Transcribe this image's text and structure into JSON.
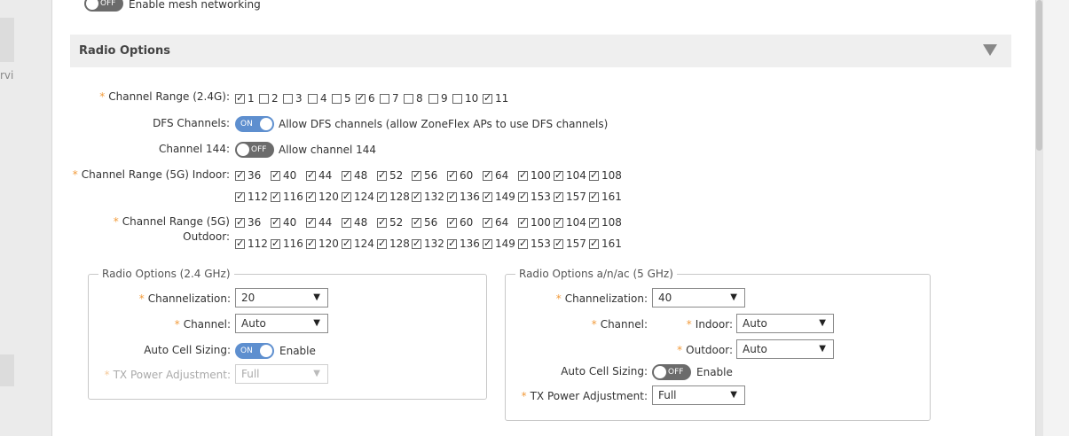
{
  "mesh": {
    "toggle": "OFF",
    "label": "Enable mesh networking"
  },
  "background": {
    "sidebar_fragment": "rvic"
  },
  "section": {
    "title": "Radio Options"
  },
  "channel_range_24": {
    "label": "Channel Range (2.4G):",
    "channels": [
      {
        "n": "1",
        "checked": true
      },
      {
        "n": "2",
        "checked": false
      },
      {
        "n": "3",
        "checked": false
      },
      {
        "n": "4",
        "checked": false
      },
      {
        "n": "5",
        "checked": false
      },
      {
        "n": "6",
        "checked": true
      },
      {
        "n": "7",
        "checked": false
      },
      {
        "n": "8",
        "checked": false
      },
      {
        "n": "9",
        "checked": false
      },
      {
        "n": "10",
        "checked": false
      },
      {
        "n": "11",
        "checked": true
      }
    ]
  },
  "dfs": {
    "label": "DFS Channels:",
    "toggle": "ON",
    "text": "Allow DFS channels (allow ZoneFlex APs to use DFS channels)"
  },
  "ch144": {
    "label": "Channel 144:",
    "toggle": "OFF",
    "text": "Allow channel 144"
  },
  "channel_range_5g_indoor": {
    "label": "Channel Range (5G) Indoor:",
    "row1": [
      "36",
      "40",
      "44",
      "48",
      "52",
      "56",
      "60",
      "64",
      "100",
      "104",
      "108"
    ],
    "row2": [
      "112",
      "116",
      "120",
      "124",
      "128",
      "132",
      "136",
      "149",
      "153",
      "157",
      "161"
    ]
  },
  "channel_range_5g_outdoor": {
    "label_line1": "Channel Range (5G)",
    "label_line2": "Outdoor:",
    "row1": [
      "36",
      "40",
      "44",
      "48",
      "52",
      "56",
      "60",
      "64",
      "100",
      "104",
      "108"
    ],
    "row2": [
      "112",
      "116",
      "120",
      "124",
      "128",
      "132",
      "136",
      "149",
      "153",
      "157",
      "161"
    ]
  },
  "radio24": {
    "legend": "Radio Options (2.4 GHz)",
    "channelization": {
      "label": "Channelization:",
      "value": "20"
    },
    "channel": {
      "label": "Channel:",
      "value": "Auto"
    },
    "auto_cell": {
      "label": "Auto Cell Sizing:",
      "toggle": "ON",
      "text": "Enable"
    },
    "tx_power": {
      "label": "TX Power Adjustment:",
      "value": "Full"
    }
  },
  "radio5": {
    "legend": "Radio Options a/n/ac (5 GHz)",
    "channelization": {
      "label": "Channelization:",
      "value": "40"
    },
    "channel": {
      "label": "Channel:"
    },
    "indoor": {
      "label": "Indoor:",
      "value": "Auto"
    },
    "outdoor": {
      "label": "Outdoor:",
      "value": "Auto"
    },
    "auto_cell": {
      "label": "Auto Cell Sizing:",
      "toggle": "OFF",
      "text": "Enable"
    },
    "tx_power": {
      "label": "TX Power Adjustment:",
      "value": "Full"
    }
  },
  "icons": {
    "dropdown": "chevron-down-icon",
    "collapse": "collapse-arrow-icon",
    "checkbox": "checkmark-icon"
  },
  "colors": {
    "toggle_on": "#5e8fcf",
    "toggle_off": "#6b6b6b",
    "required": "#f29b3b",
    "section_bg": "#efefef"
  }
}
